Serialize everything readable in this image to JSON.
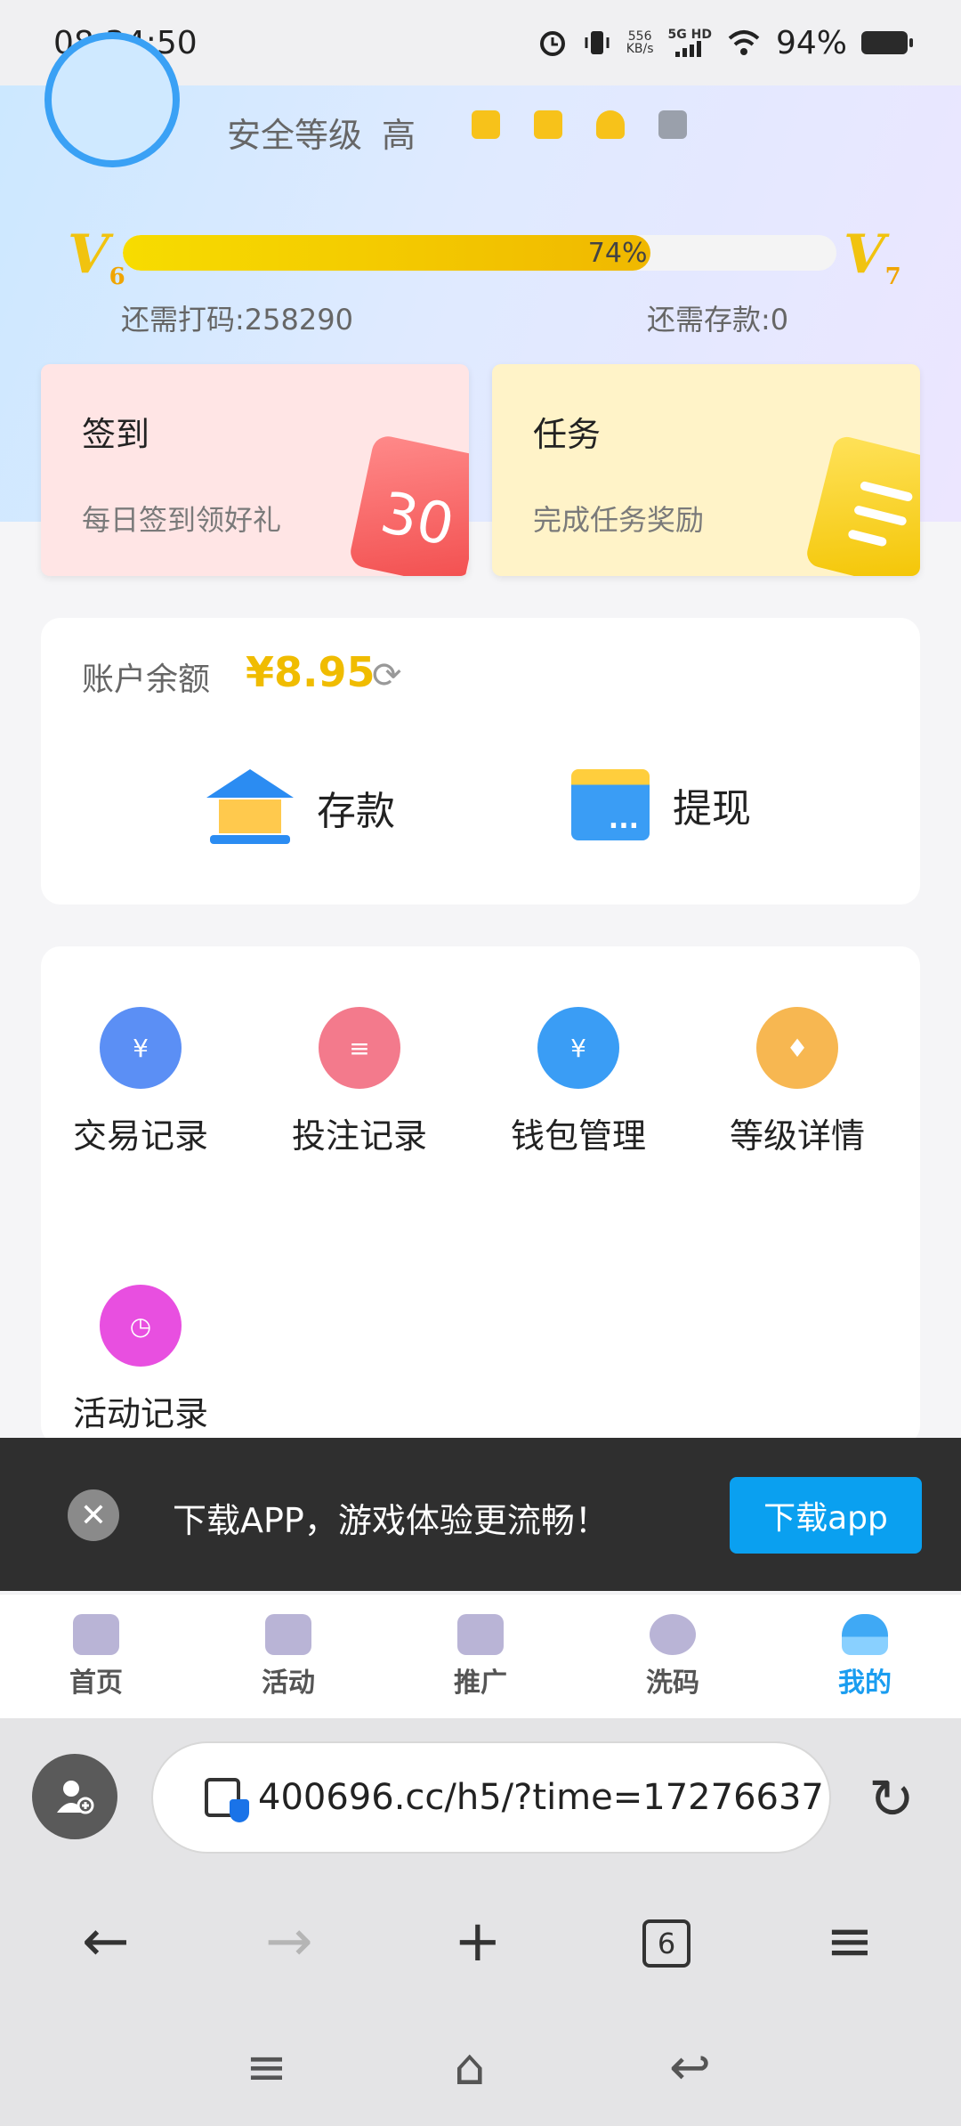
{
  "status_bar": {
    "time": "08:34:50",
    "net_speed_value": "556",
    "net_speed_unit": "KB/s",
    "network": "5G HD",
    "battery": "94%"
  },
  "profile": {
    "security_label": "安全等级",
    "security_value": "高"
  },
  "vip": {
    "current_level": "V",
    "current_level_num": "6",
    "next_level": "V",
    "next_level_num": "7",
    "progress_text": "74%",
    "progress_fraction": 0.74,
    "need_code": "还需打码:258290",
    "need_deposit": "还需存款:0"
  },
  "cards": {
    "sign": {
      "title": "签到",
      "subtitle": "每日签到领好礼",
      "icon_text": "30"
    },
    "task": {
      "title": "任务",
      "subtitle": "完成任务奖励"
    }
  },
  "balance": {
    "label": "账户余额",
    "amount": "¥8.95",
    "deposit_label": "存款",
    "withdraw_label": "提现"
  },
  "menu": {
    "items": [
      {
        "label": "交易记录",
        "icon": "transaction-icon",
        "color": "#5b8ff5"
      },
      {
        "label": "投注记录",
        "icon": "bet-record-icon",
        "color": "#f37a8c"
      },
      {
        "label": "钱包管理",
        "icon": "wallet-manage-icon",
        "color": "#3a9df5"
      },
      {
        "label": "等级详情",
        "icon": "level-icon",
        "color": "#f7b751"
      },
      {
        "label": "活动记录",
        "icon": "activity-record-icon",
        "color": "#e84fe0"
      }
    ]
  },
  "download_banner": {
    "text": "下载APP，游戏体验更流畅！",
    "button": "下载app"
  },
  "tabbar": {
    "tabs": [
      {
        "label": "首页",
        "icon": "home-icon"
      },
      {
        "label": "活动",
        "icon": "activity-icon"
      },
      {
        "label": "推广",
        "icon": "promote-icon"
      },
      {
        "label": "洗码",
        "icon": "rebate-icon"
      },
      {
        "label": "我的",
        "icon": "profile-icon",
        "active": true
      }
    ],
    "active_color": "#1a9df0"
  },
  "browser": {
    "url": "400696.cc/h5/?time=17276637",
    "tab_count": "6"
  }
}
